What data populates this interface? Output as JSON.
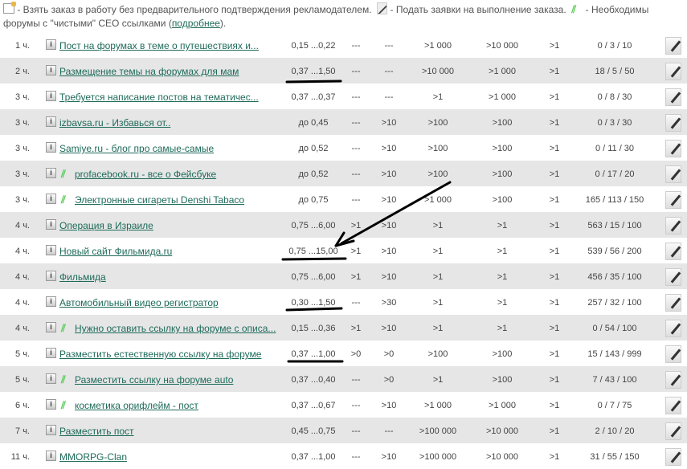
{
  "legend": {
    "take_text": " - Взять заказ в работу без предварительного подтверждения рекламодателем.",
    "apply_text": " - Подать заявки на выполнение заказа.",
    "clean_text": " - Необходимы форумы с \"чистыми\" СЕО ссылками (",
    "more_link": "подробнее",
    "tail": ")."
  },
  "rows": [
    {
      "time": "1 ч.",
      "title": "Пост на форумах в теме о путешествиях и...",
      "clip": false,
      "price": "0,15 ...0,22",
      "a": "---",
      "b": "---",
      "c": ">1 000",
      "d": ">10 000",
      "e": ">1",
      "f": "0 / 3 / 10"
    },
    {
      "time": "2 ч.",
      "title": "Размещение темы на форумах для мам",
      "clip": false,
      "price": "0,37 ...1,50",
      "a": "---",
      "b": "---",
      "c": ">10 000",
      "d": ">1 000",
      "e": ">1",
      "f": "18 / 5 / 50"
    },
    {
      "time": "3 ч.",
      "title": "Требуется написание постов на тематичес...",
      "clip": false,
      "price": "0,37 ...0,37",
      "a": "---",
      "b": "---",
      "c": ">1",
      "d": ">1 000",
      "e": ">1",
      "f": "0 / 8 / 30"
    },
    {
      "time": "3 ч.",
      "title": "izbavsa.ru - Избавься от..",
      "clip": false,
      "price": "до 0,45",
      "a": "---",
      "b": ">10",
      "c": ">100",
      "d": ">100",
      "e": ">1",
      "f": "0 / 3 / 30"
    },
    {
      "time": "3 ч.",
      "title": "Samiye.ru - блог про самые-самые",
      "clip": false,
      "price": "до 0,52",
      "a": "---",
      "b": ">10",
      "c": ">100",
      "d": ">100",
      "e": ">1",
      "f": "0 / 11 / 30"
    },
    {
      "time": "3 ч.",
      "title": "profacebook.ru - все о Фейсбуке",
      "clip": true,
      "price": "до 0,52",
      "a": "---",
      "b": ">10",
      "c": ">100",
      "d": ">100",
      "e": ">1",
      "f": "0 / 17 / 20"
    },
    {
      "time": "3 ч.",
      "title": "Электронные сигареты Denshi Tabaco",
      "clip": true,
      "price": "до 0,75",
      "a": "---",
      "b": ">10",
      "c": ">1 000",
      "d": ">100",
      "e": ">1",
      "f": "165 / 113 / 150"
    },
    {
      "time": "4 ч.",
      "title": "Операция в Израиле",
      "clip": false,
      "price": "0,75 ...6,00",
      "a": ">1",
      "b": ">10",
      "c": ">1",
      "d": ">1",
      "e": ">1",
      "f": "563 / 15 / 100"
    },
    {
      "time": "4 ч.",
      "title": "Новый сайт Фильмида.ru",
      "clip": false,
      "price": "0,75 ...15,00",
      "a": ">1",
      "b": ">10",
      "c": ">1",
      "d": ">1",
      "e": ">1",
      "f": "539 / 56 / 200"
    },
    {
      "time": "4 ч.",
      "title": "Фильмида",
      "clip": false,
      "price": "0,75 ...6,00",
      "a": ">1",
      "b": ">10",
      "c": ">1",
      "d": ">1",
      "e": ">1",
      "f": "456 / 35 / 100"
    },
    {
      "time": "4 ч.",
      "title": "Автомобильный видео регистратор",
      "clip": false,
      "price": "0,30 ...1,50",
      "a": "---",
      "b": ">30",
      "c": ">1",
      "d": ">1",
      "e": ">1",
      "f": "257 / 32 / 100"
    },
    {
      "time": "4 ч.",
      "title": "Нужно оставить ссылку на форуме с описа...",
      "clip": true,
      "price": "0,15 ...0,36",
      "a": ">1",
      "b": ">10",
      "c": ">1",
      "d": ">1",
      "e": ">1",
      "f": "0 / 54 / 100"
    },
    {
      "time": "5 ч.",
      "title": "Разместить естественную ссылку на форуме",
      "clip": false,
      "price": "0,37 ...1,00",
      "a": ">0",
      "b": ">0",
      "c": ">100",
      "d": ">100",
      "e": ">1",
      "f": "15 / 143 / 999"
    },
    {
      "time": "5 ч.",
      "title": "Разместить ссылку на форуме auto",
      "clip": true,
      "price": "0,37 ...0,40",
      "a": "---",
      "b": ">0",
      "c": ">1",
      "d": ">100",
      "e": ">1",
      "f": "7 / 43 / 100"
    },
    {
      "time": "6 ч.",
      "title": "косметика орифлейм - пост",
      "clip": true,
      "price": "0,37 ...0,67",
      "a": "---",
      "b": ">10",
      "c": ">1 000",
      "d": ">1 000",
      "e": ">1",
      "f": "0 / 7 / 75"
    },
    {
      "time": "7 ч.",
      "title": "Разместить пост",
      "clip": false,
      "price": "0,45 ...0,75",
      "a": "---",
      "b": "---",
      "c": ">100 000",
      "d": ">10 000",
      "e": ">1",
      "f": "2 / 10 / 20"
    },
    {
      "time": "11 ч.",
      "title": "MMORPG-Clan",
      "clip": false,
      "price": "0,37 ...1,00",
      "a": "---",
      "b": ">10",
      "c": ">100 000",
      "d": ">10 000",
      "e": ">1",
      "f": "31 / 55 / 150"
    }
  ]
}
